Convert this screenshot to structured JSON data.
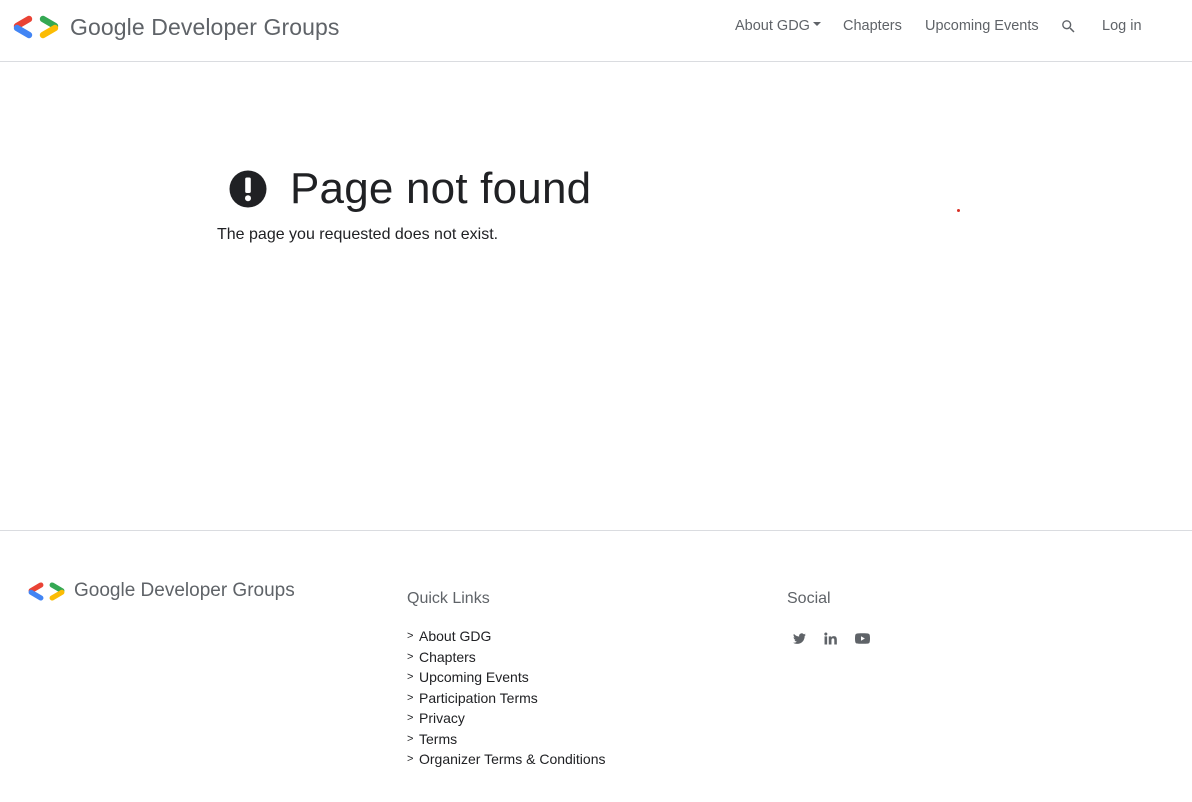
{
  "header": {
    "brand": "Google Developer Groups",
    "nav": {
      "about": "About GDG",
      "chapters": "Chapters",
      "events": "Upcoming Events",
      "search_icon": "search-icon",
      "login": "Log in"
    }
  },
  "main": {
    "icon": "exclamation-circle-icon",
    "title": "Page not found",
    "message": "The page you requested does not exist."
  },
  "footer": {
    "brand": "Google Developer Groups",
    "quick_links": {
      "heading": "Quick Links",
      "items": [
        "About GDG",
        "Chapters",
        "Upcoming Events",
        "Participation Terms",
        "Privacy",
        "Terms",
        "Organizer Terms & Conditions"
      ]
    },
    "social": {
      "heading": "Social",
      "icons": [
        "twitter-icon",
        "linkedin-icon",
        "youtube-icon"
      ]
    }
  },
  "colors": {
    "logo_red": "#EA4335",
    "logo_blue": "#4285F4",
    "logo_yellow": "#FBBC04",
    "logo_green": "#34A853",
    "text_primary": "#202124",
    "text_secondary": "#5F6368",
    "divider": "#DADCE0"
  }
}
